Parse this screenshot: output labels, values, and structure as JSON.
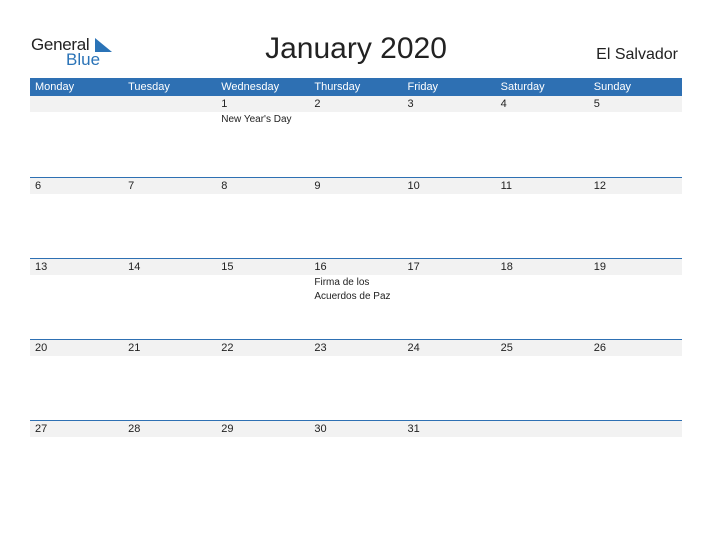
{
  "logo": {
    "general": "General",
    "blue": "Blue"
  },
  "title": "January 2020",
  "country": "El Salvador",
  "weekdays": [
    "Monday",
    "Tuesday",
    "Wednesday",
    "Thursday",
    "Friday",
    "Saturday",
    "Sunday"
  ],
  "weeks": [
    {
      "days": [
        "",
        "",
        "1",
        "2",
        "3",
        "4",
        "5"
      ],
      "events": [
        "",
        "",
        "New Year's Day",
        "",
        "",
        "",
        ""
      ]
    },
    {
      "days": [
        "6",
        "7",
        "8",
        "9",
        "10",
        "11",
        "12"
      ],
      "events": [
        "",
        "",
        "",
        "",
        "",
        "",
        ""
      ]
    },
    {
      "days": [
        "13",
        "14",
        "15",
        "16",
        "17",
        "18",
        "19"
      ],
      "events": [
        "",
        "",
        "",
        "Firma de los Acuerdos de Paz",
        "",
        "",
        ""
      ]
    },
    {
      "days": [
        "20",
        "21",
        "22",
        "23",
        "24",
        "25",
        "26"
      ],
      "events": [
        "",
        "",
        "",
        "",
        "",
        "",
        ""
      ]
    },
    {
      "days": [
        "27",
        "28",
        "29",
        "30",
        "31",
        "",
        ""
      ],
      "events": [
        "",
        "",
        "",
        "",
        "",
        "",
        ""
      ]
    }
  ]
}
